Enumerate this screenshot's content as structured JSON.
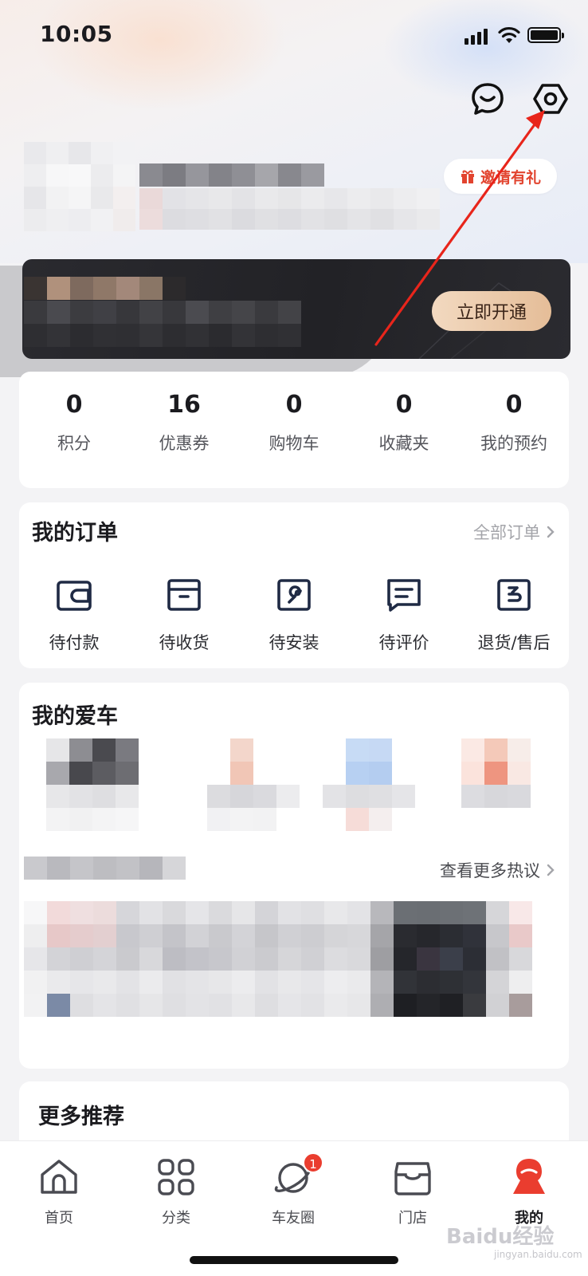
{
  "status_bar": {
    "time": "10:05"
  },
  "header": {
    "icons": [
      "message-icon",
      "settings-icon"
    ],
    "invite_label": "邀请有礼"
  },
  "vip": {
    "button_label": "立即开通"
  },
  "stats": [
    {
      "value": "0",
      "label": "积分"
    },
    {
      "value": "16",
      "label": "优惠券"
    },
    {
      "value": "0",
      "label": "购物车"
    },
    {
      "value": "0",
      "label": "收藏夹"
    },
    {
      "value": "0",
      "label": "我的预约"
    }
  ],
  "orders": {
    "title": "我的订单",
    "all_label": "全部订单",
    "items": [
      {
        "label": "待付款",
        "icon": "wallet-icon"
      },
      {
        "label": "待收货",
        "icon": "package-icon"
      },
      {
        "label": "待安装",
        "icon": "wrench-icon"
      },
      {
        "label": "待评价",
        "icon": "comment-icon"
      },
      {
        "label": "退货/售后",
        "icon": "return-icon"
      }
    ]
  },
  "cars": {
    "title": "我的爱车",
    "more_hot_label": "查看更多热议"
  },
  "recommend": {
    "title": "更多推荐"
  },
  "tabbar": {
    "items": [
      {
        "label": "首页",
        "icon": "home-icon"
      },
      {
        "label": "分类",
        "icon": "category-icon"
      },
      {
        "label": "车友圈",
        "icon": "planet-icon",
        "badge": "1"
      },
      {
        "label": "门店",
        "icon": "store-icon"
      },
      {
        "label": "我的",
        "icon": "profile-icon",
        "active": true
      }
    ]
  },
  "watermark": {
    "text": "Baidu经验",
    "sub": "jingyan.baidu.com"
  },
  "colors": {
    "accent": "#ea3d2f",
    "vip_gold": "#e5bd98",
    "annotation": "#e8251b"
  }
}
